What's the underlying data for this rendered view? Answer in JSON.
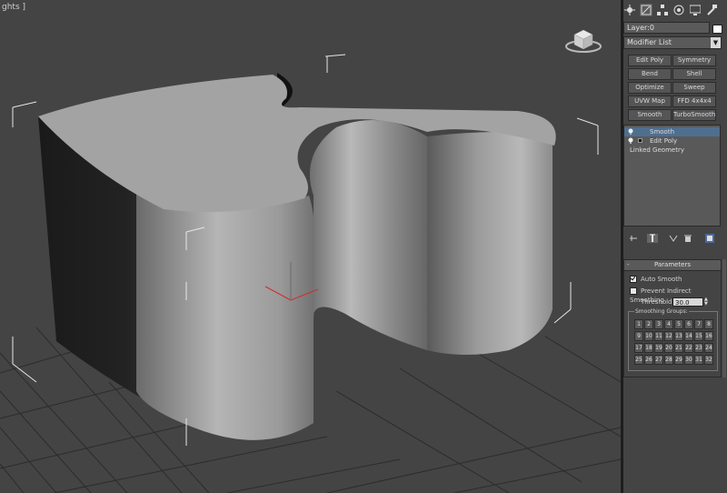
{
  "viewport": {
    "label": "ghts ]",
    "viewcube_icon": "viewcube-icon"
  },
  "panel": {
    "tabs": [
      "create-tab-icon",
      "modify-tab-icon",
      "hierarchy-tab-icon",
      "motion-tab-icon",
      "display-tab-icon",
      "utilities-tab-icon"
    ],
    "layer": "Layer:0",
    "modifier_list": "Modifier List",
    "modifier_buttons": [
      "Edit Poly",
      "Symmetry",
      "Bend",
      "Shell",
      "Optimize",
      "Sweep",
      "UVW Map",
      "FFD 4x4x4",
      "Smooth",
      "TurboSmooth"
    ],
    "stack": [
      {
        "label": "Smooth",
        "selected": true,
        "has_box": false
      },
      {
        "label": "Edit Poly",
        "selected": false,
        "has_box": true
      },
      {
        "label": "Linked Geometry",
        "selected": false,
        "has_box": false
      }
    ],
    "parameters": {
      "title": "Parameters",
      "collapse": "-",
      "auto_smooth": "Auto Smooth",
      "auto_smooth_checked": true,
      "prevent_indirect": "Prevent Indirect Smoothing",
      "prevent_indirect_checked": false,
      "threshold_label": "Threshold:",
      "threshold_value": "30.0",
      "smoothing_groups_label": "Smoothing Groups:",
      "groups": [
        "1",
        "2",
        "3",
        "4",
        "5",
        "6",
        "7",
        "8",
        "9",
        "10",
        "11",
        "12",
        "13",
        "14",
        "15",
        "16",
        "17",
        "18",
        "19",
        "20",
        "21",
        "22",
        "23",
        "24",
        "25",
        "26",
        "27",
        "28",
        "29",
        "30",
        "31",
        "32"
      ]
    }
  },
  "colors": {
    "viewport_bg": "#444444",
    "panel_bg": "#444444",
    "selection": "#4f6f8f",
    "gizmo": "#d03030"
  }
}
